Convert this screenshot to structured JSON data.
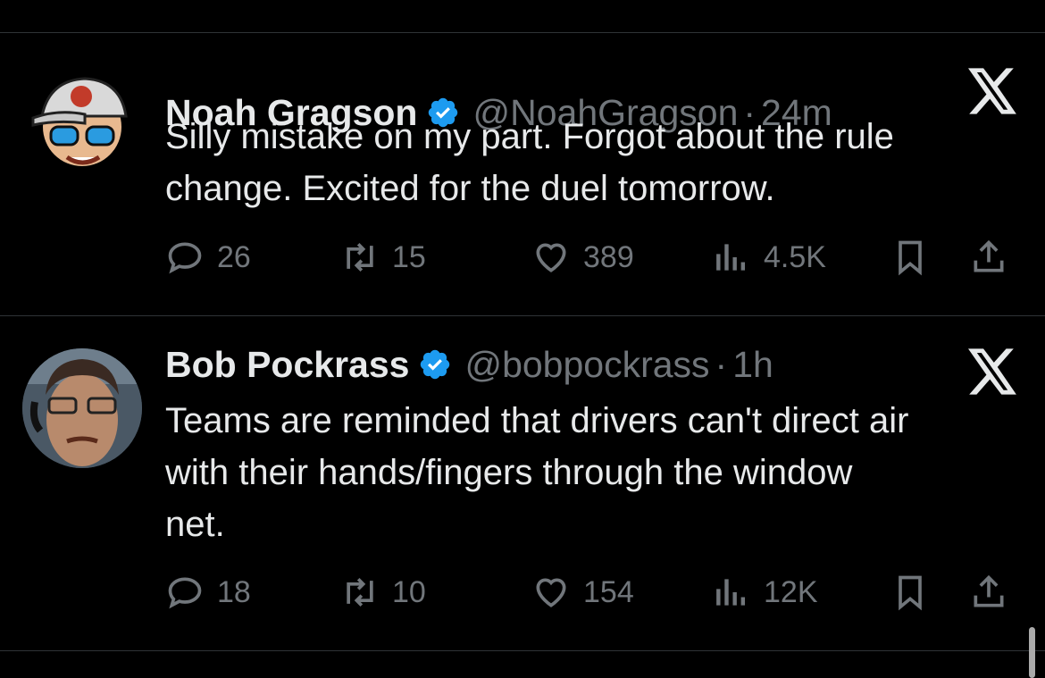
{
  "tweets": [
    {
      "name": "Noah Gragson",
      "handle": "@NoahGragson",
      "dot": "·",
      "time": "24m",
      "text": "Silly mistake on my part. Forgot about the rule\nchange. Excited for the duel tomorrow.",
      "replies": "26",
      "retweets": "15",
      "likes": "389",
      "views": "4.5K"
    },
    {
      "name": "Bob Pockrass",
      "handle": "@bobpockrass",
      "dot": "·",
      "time": "1h",
      "text": "Teams are reminded that drivers can't direct air\nwith their hands/fingers through the window\nnet.",
      "replies": "18",
      "retweets": "10",
      "likes": "154",
      "views": "12K"
    }
  ],
  "colors": {
    "background": "#000000",
    "text": "#e7e9ea",
    "muted": "#71767b",
    "verified": "#1d9bf0",
    "divider": "#2f3336"
  },
  "icons": [
    "verified-badge-icon",
    "x-logo-icon",
    "reply-icon",
    "retweet-icon",
    "like-icon",
    "views-icon",
    "bookmark-icon",
    "share-icon"
  ]
}
